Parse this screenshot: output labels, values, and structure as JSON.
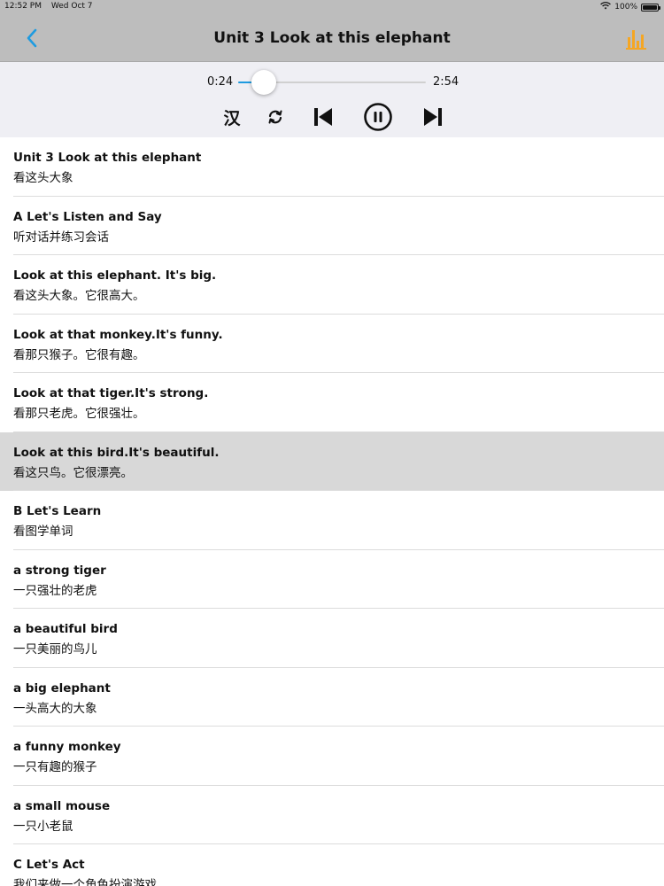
{
  "status_bar": {
    "time": "12:52 PM",
    "date": "Wed Oct 7",
    "wifi_icon": "wifi-icon",
    "battery_text": "100%",
    "battery_icon": "battery-icon"
  },
  "nav": {
    "back_icon": "chevron-left-icon",
    "title": "Unit 3 Look at this elephant",
    "chart_icon": "bar-chart-icon",
    "accent_color": "#1e9be0",
    "chart_color": "#f5a623"
  },
  "player": {
    "current_time": "0:24",
    "total_time": "2:54",
    "progress": 0.138,
    "translate_toggle_label": "汉",
    "repeat_icon": "repeat-icon",
    "prev_icon": "skip-previous-icon",
    "pause_icon": "pause-circle-icon",
    "next_icon": "skip-next-icon"
  },
  "sentences": [
    {
      "en": "Unit 3 Look at this elephant",
      "cn": "看这头大象",
      "selected": false
    },
    {
      "en": "A Let's Listen and Say",
      "cn": "听对话并练习会话",
      "selected": false
    },
    {
      "en": "Look at this elephant. It's big.",
      "cn": "看这头大象。它很高大。",
      "selected": false
    },
    {
      "en": "Look at that monkey.It's funny.",
      "cn": "看那只猴子。它很有趣。",
      "selected": false
    },
    {
      "en": "Look at that tiger.It's strong.",
      "cn": "看那只老虎。它很强壮。",
      "selected": false
    },
    {
      "en": "Look at this bird.It's beautiful.",
      "cn": "看这只鸟。它很漂亮。",
      "selected": true
    },
    {
      "en": "B Let's Learn",
      "cn": "看图学单词",
      "selected": false
    },
    {
      "en": "a strong tiger",
      "cn": "一只强壮的老虎",
      "selected": false
    },
    {
      "en": "a beautiful bird",
      "cn": "一只美丽的鸟儿",
      "selected": false
    },
    {
      "en": "a big elephant",
      "cn": "一头高大的大象",
      "selected": false
    },
    {
      "en": "a funny monkey",
      "cn": "一只有趣的猴子",
      "selected": false
    },
    {
      "en": "a small mouse",
      "cn": "一只小老鼠",
      "selected": false
    },
    {
      "en": "C Let's Act",
      "cn": "我们来做一个角色扮演游戏",
      "selected": false
    }
  ]
}
